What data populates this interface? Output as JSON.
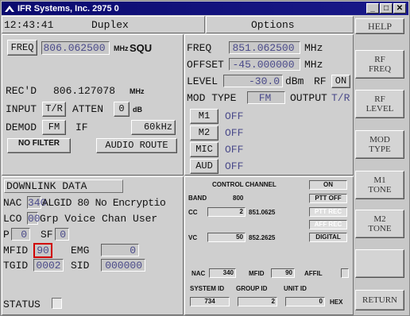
{
  "window": {
    "title": "IFR Systems, Inc. 2975 0",
    "min": "_",
    "max": "□",
    "close": "✕"
  },
  "header": {
    "time": "12:43:41",
    "mode": "Duplex",
    "screen": "Options",
    "help": "HELP"
  },
  "left": {
    "freq_btn": "FREQ",
    "freq_val": "806.062500",
    "freq_unit": "MHz",
    "squ": "SQU",
    "rec_label": "REC'D",
    "rec_val": "806.127078",
    "rec_unit": "MHz",
    "input_label": "INPUT",
    "input_val": "T/R",
    "atten_label": "ATTEN",
    "atten_val": "0",
    "atten_unit": "dB",
    "demod_label": "DEMOD",
    "demod_val": "FM",
    "if_label": "IF",
    "if_val": "60kHz",
    "filter_btn": "NO FILTER",
    "audio_btn": "AUDIO ROUTE"
  },
  "right_top": {
    "freq_label": "FREQ",
    "freq_val": "851.062500",
    "freq_unit": "MHz",
    "offset_label": "OFFSET",
    "offset_val": "-45.000000",
    "offset_unit": "MHz",
    "level_label": "LEVEL",
    "level_val": "-30.0",
    "level_unit": "dBm",
    "rf_label": "RF",
    "rf_val": "ON",
    "modtype_label": "MOD TYPE",
    "modtype_val": "FM",
    "output_label": "OUTPUT",
    "output_val": "T/R",
    "mods": [
      {
        "label": "M1",
        "state": "OFF"
      },
      {
        "label": "M2",
        "state": "OFF"
      },
      {
        "label": "MIC",
        "state": "OFF"
      },
      {
        "label": "AUD",
        "state": "OFF"
      }
    ]
  },
  "downlink": {
    "title": "DOWNLINK DATA",
    "nac_label": "NAC",
    "nac_val": "340",
    "algid_text": "ALGID 80 No Encryptio",
    "lco_label": "LCO",
    "lco_val": "00",
    "lco_text": "Grp Voice Chan User",
    "p_label": "P",
    "p_val": "0",
    "sf_label": "SF",
    "sf_val": "0",
    "mfid_label": "MFID",
    "mfid_val": "90",
    "emg_label": "EMG",
    "emg_val": "0",
    "tgid_label": "TGID",
    "tgid_val": "0002",
    "sid_label": "SID",
    "sid_val": "000000",
    "status_label": "STATUS"
  },
  "control": {
    "title": "CONTROL CHANNEL",
    "on": "ON",
    "band_label": "BAND",
    "band_val": "800",
    "ptt_off": "PTT OFF",
    "cc_label": "CC",
    "cc_val": "2",
    "cc_freq": "851.0625",
    "ptt_rec": "PTT REC",
    "aff_rec": "AFF REC",
    "vc_label": "VC",
    "vc_val": "50",
    "vc_freq": "852.2625",
    "digital": "DIGITAL",
    "nac_label": "NAC",
    "nac_val": "340",
    "mfid_label": "MFID",
    "mfid_val": "90",
    "affil_label": "AFFIL",
    "sys_label": "SYSTEM ID",
    "group_label": "GROUP ID",
    "unit_label": "UNIT ID",
    "sys_val": "734",
    "group_val": "2",
    "unit_val": "0",
    "hex": "HEX"
  },
  "sidebar": [
    {
      "l1": "RF",
      "l2": "FREQ"
    },
    {
      "l1": "RF",
      "l2": "LEVEL"
    },
    {
      "l1": "MOD",
      "l2": "TYPE"
    },
    {
      "l1": "M1",
      "l2": "TONE"
    },
    {
      "l1": "M2",
      "l2": "TONE"
    },
    {
      "l1": "",
      "l2": ""
    },
    {
      "l1": "RETURN",
      "l2": ""
    }
  ],
  "colors": {
    "titlebar": "#0a0a6e",
    "value_text": "#4a4a8a",
    "highlight": "#d00000"
  }
}
